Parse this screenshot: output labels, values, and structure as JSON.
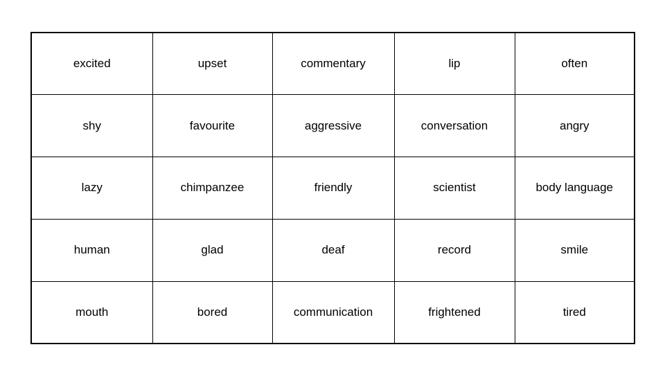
{
  "document": {
    "type": "word-grid-table",
    "background_color": "#ffffff",
    "text_color": "#000000",
    "border_color": "#000000",
    "rows": 5,
    "columns": 5
  },
  "table": {
    "name": "vocabulary-word-grid",
    "cells": [
      [
        "excited",
        "upset",
        "commentary",
        "lip",
        "often"
      ],
      [
        "shy",
        "favourite",
        "aggressive",
        "conversation",
        "angry"
      ],
      [
        "lazy",
        "chimpanzee",
        "friendly",
        "scientist",
        "body language"
      ],
      [
        "human",
        "glad",
        "deaf",
        "record",
        "smile"
      ],
      [
        "mouth",
        "bored",
        "communication",
        "frightened",
        "tired"
      ]
    ]
  }
}
